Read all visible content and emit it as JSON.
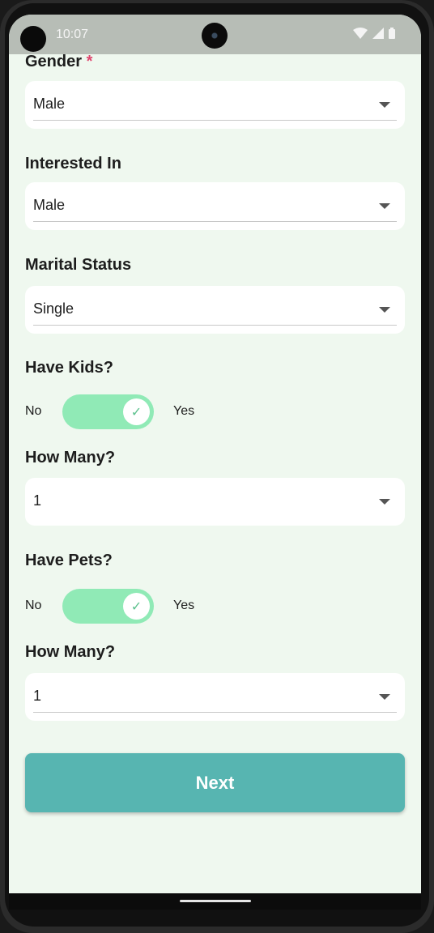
{
  "status_bar": {
    "time": "10:07"
  },
  "form": {
    "gender": {
      "label": "Gender",
      "required_mark": "*",
      "value": "Male"
    },
    "interested_in": {
      "label": "Interested In",
      "value": "Male"
    },
    "marital_status": {
      "label": "Marital Status",
      "value": "Single"
    },
    "have_kids": {
      "label": "Have Kids?",
      "off_label": "No",
      "on_label": "Yes",
      "checked": true
    },
    "kids_count": {
      "label": "How Many?",
      "value": "1"
    },
    "have_pets": {
      "label": "Have Pets?",
      "off_label": "No",
      "on_label": "Yes",
      "checked": true
    },
    "pets_count": {
      "label": "How Many?",
      "value": "1"
    },
    "next_label": "Next"
  },
  "colors": {
    "accent": "#57b5b1",
    "toggle_on": "#90eab6",
    "required": "#e0456e",
    "background": "#eff8ef"
  }
}
